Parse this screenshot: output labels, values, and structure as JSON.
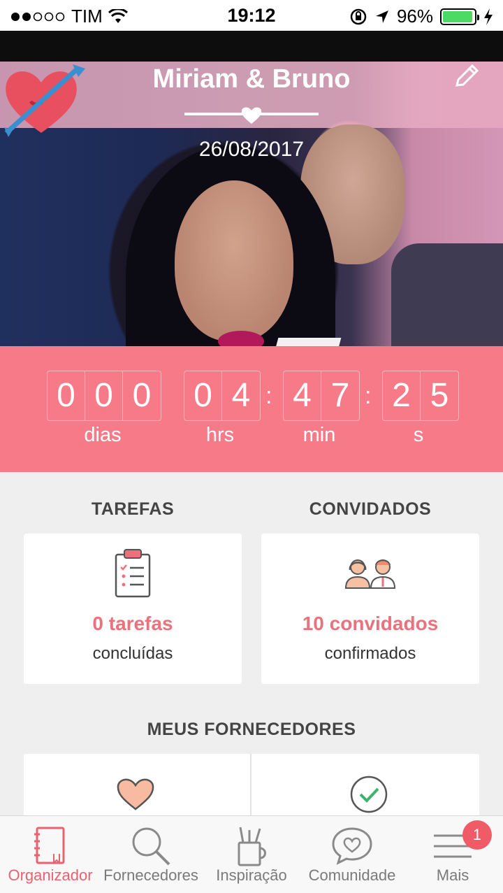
{
  "status_bar": {
    "carrier": "TIM",
    "time": "19:12",
    "battery": "96%",
    "battery_level": 0.96
  },
  "header": {
    "names": "Miriam & Bruno",
    "date": "26/08/2017"
  },
  "countdown": {
    "days": [
      "0",
      "0",
      "0"
    ],
    "hours": [
      "0",
      "4"
    ],
    "minutes": [
      "4",
      "7"
    ],
    "seconds": [
      "2",
      "5"
    ],
    "days_label": "dias",
    "hours_label": "hrs",
    "minutes_label": "min",
    "seconds_label": "s",
    "separator": ":"
  },
  "tasks": {
    "title": "TAREFAS",
    "count": "0 tarefas",
    "sub": "concluídas"
  },
  "guests": {
    "title": "CONVIDADOS",
    "count": "10 convidados",
    "sub": "confirmados"
  },
  "vendors": {
    "title": "MEUS FORNECEDORES"
  },
  "tab_bar": {
    "items": [
      {
        "label": "Organizador",
        "icon": "notebook-icon",
        "active": true
      },
      {
        "label": "Fornecedores",
        "icon": "search-icon"
      },
      {
        "label": "Inspiração",
        "icon": "tools-cup-icon"
      },
      {
        "label": "Comunidade",
        "icon": "chat-heart-icon"
      },
      {
        "label": "Mais",
        "icon": "menu-icon"
      }
    ],
    "badge": "1"
  },
  "colors": {
    "accent": "#f77a88",
    "accent_text": "#e9727c",
    "tab_active": "#e8636f"
  }
}
